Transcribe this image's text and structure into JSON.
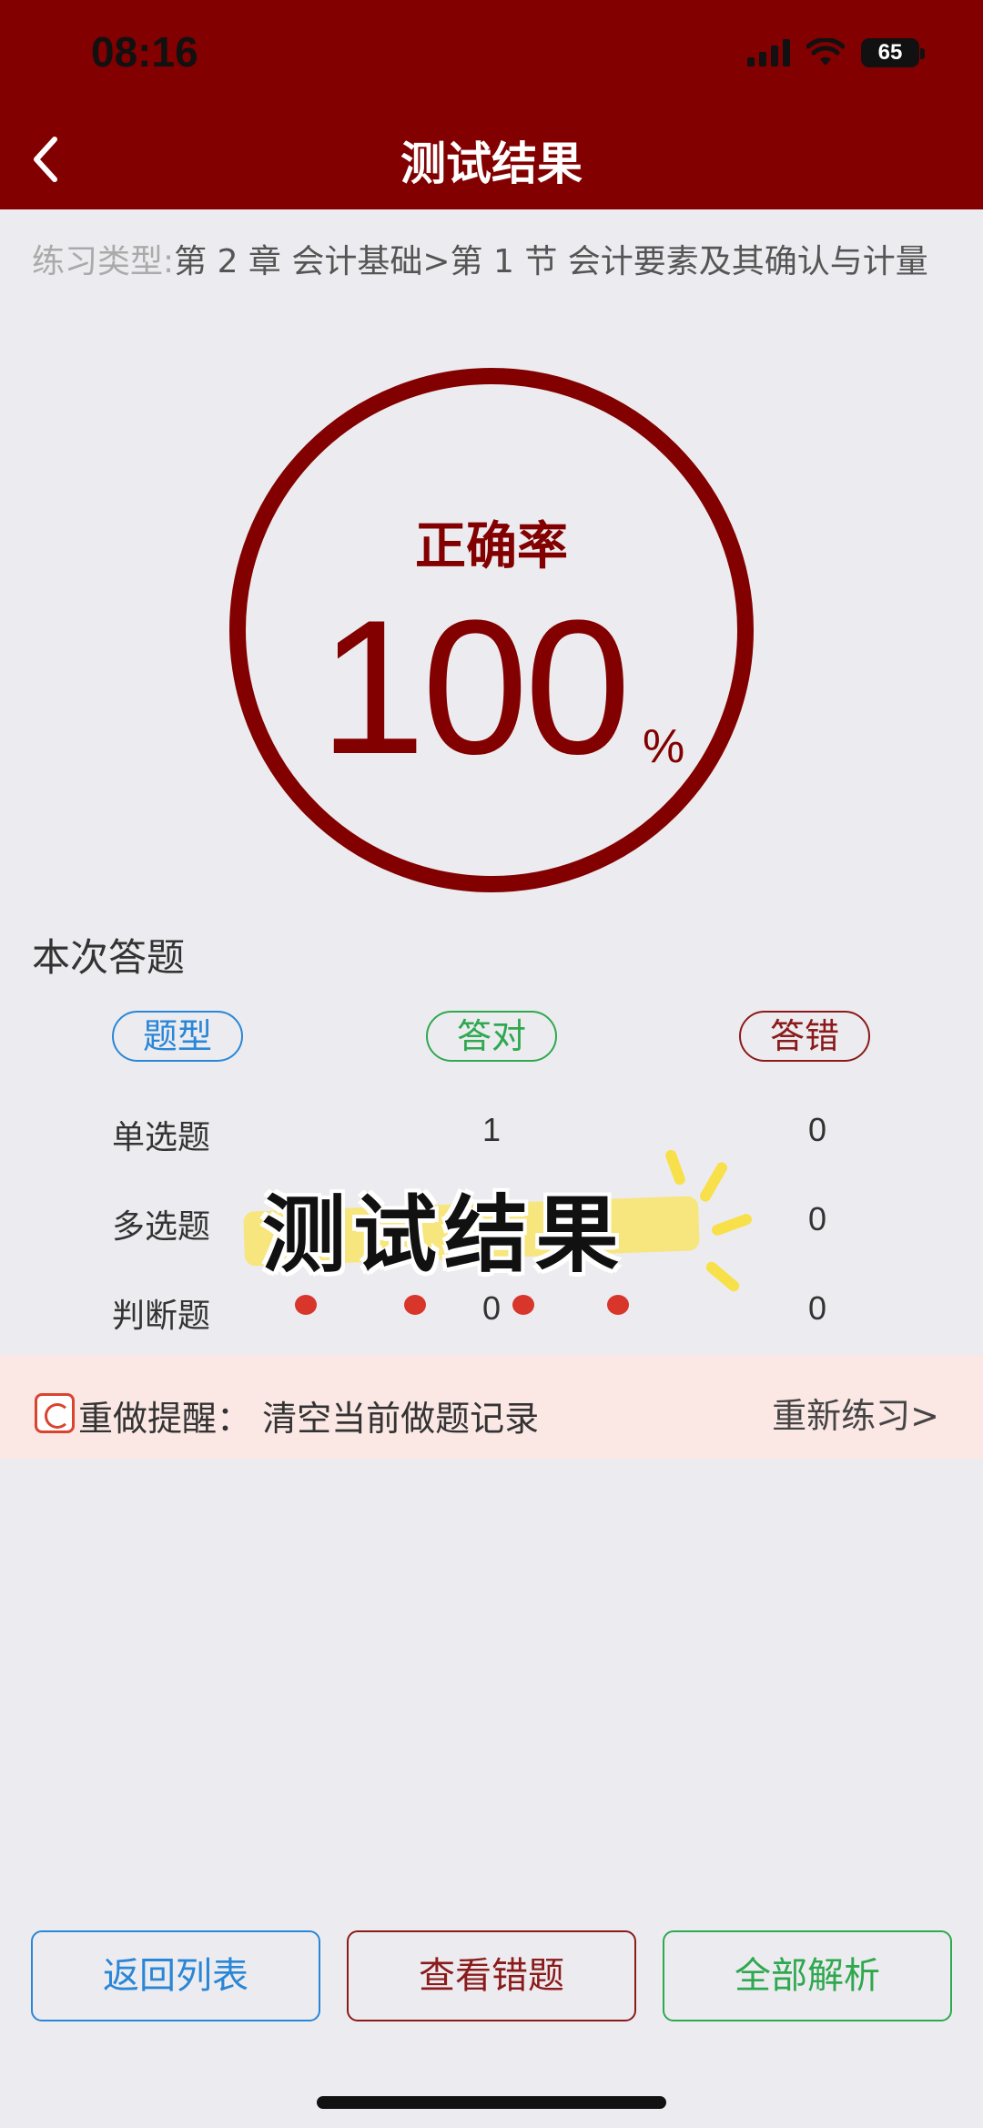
{
  "status_bar": {
    "time": "08:16",
    "battery": "65"
  },
  "header": {
    "title": "测试结果"
  },
  "practice": {
    "label": "练习类型:",
    "value": "第 2 章 会计基础>第 1 节 会计要素及其确认与计量"
  },
  "accuracy": {
    "label": "正确率",
    "value": "100",
    "unit": "%"
  },
  "summary": {
    "title": "本次答题",
    "headers": {
      "type": "题型",
      "correct": "答对",
      "wrong": "答错"
    },
    "rows": [
      {
        "name": "单选题",
        "correct": "1",
        "wrong": "0"
      },
      {
        "name": "多选题",
        "correct": "",
        "wrong": "0"
      },
      {
        "name": "判断题",
        "correct": "0",
        "wrong": "0"
      }
    ]
  },
  "sticker": {
    "text": "测试结果"
  },
  "redo": {
    "label": "重做提醒：  清空当前做题记录",
    "link": "重新练习>"
  },
  "buttons": {
    "back_list": "返回列表",
    "view_wrong": "查看错题",
    "all_analysis": "全部解析"
  },
  "colors": {
    "brand": "#830000",
    "blue": "#2a86d6",
    "green": "#2fa84f",
    "background": "#ececf0"
  }
}
